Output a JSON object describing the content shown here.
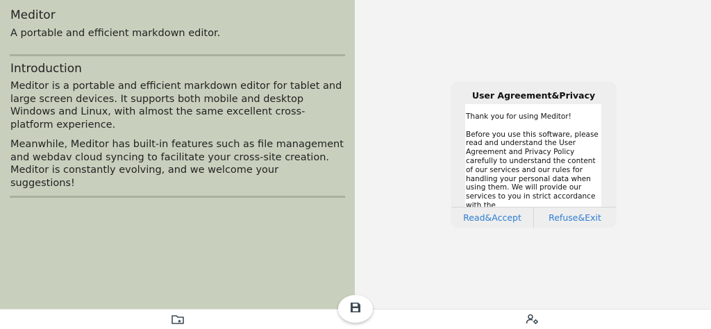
{
  "app": {
    "title": "Meditor",
    "subtitle": "A portable and efficient markdown editor."
  },
  "intro": {
    "heading": "Introduction",
    "paragraph1": "Meditor is a portable and efficient markdown editor for tablet and large screen devices. It supports both mobile and desktop Windows and Linux, with almost the same excellent cross-platform experience.",
    "paragraph2": "Meanwhile, Meditor has built-in features such as file management and webdav cloud syncing to facilitate your cross-site creation. Meditor is constantly evolving, and we welcome your suggestions!"
  },
  "dialog": {
    "title": "User Agreement&Privacy",
    "body": "Thank you for using Meditor!\n\nBefore you use this software, please read and understand the User Agreement and Privacy Policy carefully to understand the content of our services and our rules for handling your personal data when using them. We will provide our services to you in strict accordance with the",
    "accept_label": "Read&Accept",
    "refuse_label": "Refuse&Exit"
  },
  "bottom_nav": {
    "left_icon": "folder-icon",
    "center_icon": "save-icon",
    "right_icon": "user-settings-icon"
  },
  "colors": {
    "left_panel": "#c8d0bd",
    "accent": "#2b7cd3",
    "icon": "#3d4a55"
  }
}
